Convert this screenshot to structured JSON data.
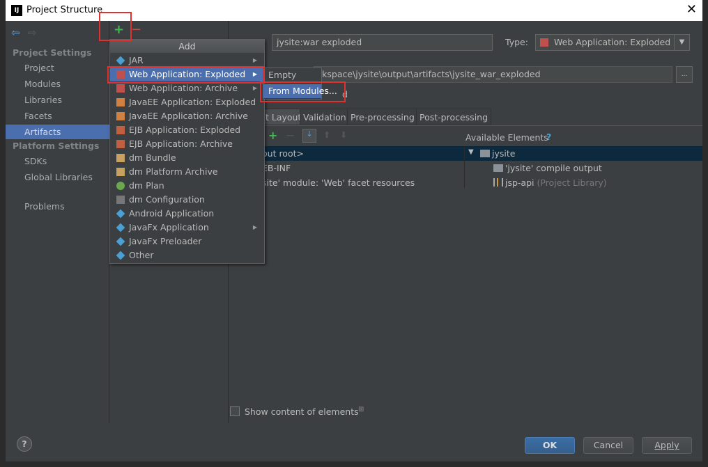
{
  "window": {
    "title": "Project Structure",
    "logo": "IJ",
    "close": "✕"
  },
  "sidebar": {
    "sections": [
      {
        "title": "Project Settings",
        "items": [
          "Project",
          "Modules",
          "Libraries",
          "Facets",
          "Artifacts"
        ]
      },
      {
        "title": "Platform Settings",
        "items": [
          "SDKs",
          "Global Libraries"
        ]
      }
    ],
    "problems": "Problems",
    "selected": "Artifacts"
  },
  "toolbar": {
    "add": "+",
    "remove": "−"
  },
  "artifact": {
    "name": "jysite:war exploded",
    "type_label": "Type:",
    "type_value": "Web Application: Exploded",
    "output_dir": "rkspace\\jysite\\output\\artifacts\\jysite_war_exploded",
    "browse": "...",
    "partial_label": "d"
  },
  "tabs": [
    "t Layout",
    "Validation",
    "Pre-processing",
    "Post-processing"
  ],
  "layout_tree": [
    "out root>",
    "EB-INF",
    "site' module: 'Web' facet resources"
  ],
  "available": {
    "title": "Available Elements",
    "help": "?",
    "root": "jysite",
    "children": [
      {
        "label": "'jysite' compile output",
        "extra": ""
      },
      {
        "label": "jsp-api",
        "extra": "(Project Library)"
      }
    ]
  },
  "show_content": "Show content of elements",
  "menu": {
    "title": "Add",
    "items": [
      {
        "label": "JAR",
        "icon": "jar-icon",
        "submenu": true
      },
      {
        "label": "Web Application: Exploded",
        "icon": "web-app-icon",
        "submenu": true,
        "selected": true
      },
      {
        "label": "Web Application: Archive",
        "icon": "web-app-icon",
        "submenu": true
      },
      {
        "label": "JavaEE Application: Exploded",
        "icon": "javaee-icon"
      },
      {
        "label": "JavaEE Application: Archive",
        "icon": "javaee-icon"
      },
      {
        "label": "EJB Application: Exploded",
        "icon": "ejb-icon"
      },
      {
        "label": "EJB Application: Archive",
        "icon": "ejb-icon"
      },
      {
        "label": "dm Bundle",
        "icon": "dm-bundle-icon"
      },
      {
        "label": "dm Platform Archive",
        "icon": "dm-platform-icon"
      },
      {
        "label": "dm Plan",
        "icon": "dm-plan-icon"
      },
      {
        "label": "dm Configuration",
        "icon": "dm-config-icon"
      },
      {
        "label": "Android Application",
        "icon": "jar-icon"
      },
      {
        "label": "JavaFx Application",
        "icon": "jar-icon",
        "submenu": true
      },
      {
        "label": "JavaFx Preloader",
        "icon": "jar-icon"
      },
      {
        "label": "Other",
        "icon": "jar-icon"
      }
    ]
  },
  "submenu": {
    "items": [
      "Empty",
      "From Modules..."
    ]
  },
  "buttons": {
    "ok": "OK",
    "cancel": "Cancel",
    "apply": "Apply",
    "help": "?"
  },
  "colors": {
    "accent": "#4b6eaf",
    "highlight": "#e03030",
    "background": "#3c3f41"
  }
}
